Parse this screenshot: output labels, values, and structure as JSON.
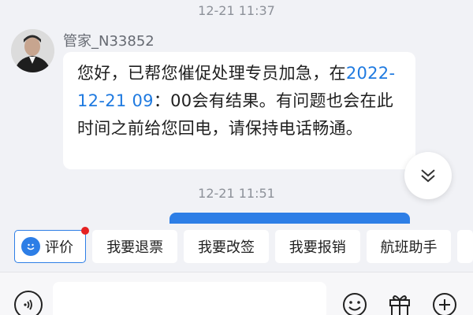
{
  "chat": {
    "timestamps": [
      "12-21 11:37",
      "12-21 11:51"
    ],
    "agent": {
      "name": "管家_N33852",
      "message": {
        "part1": "您好，已帮您催促处理专员加急，在",
        "link": "2022-12-21 09",
        "part2": "：00会有结果。有问题也会在此时间之前给您回电，请保持电话畅通。"
      }
    }
  },
  "quick_actions": {
    "rate_label": "评价",
    "items": [
      "我要退票",
      "我要改签",
      "我要报销",
      "航班助手"
    ]
  },
  "colors": {
    "accent": "#2d7ee6",
    "link": "#1f7ae0",
    "badge": "#e52222",
    "background": "#f1f2f6"
  },
  "icons": {
    "scroll": "chevron-down-icon",
    "voice": "voice-icon",
    "emoji": "smiley-icon",
    "gift": "gift-icon",
    "plus": "plus-icon"
  }
}
